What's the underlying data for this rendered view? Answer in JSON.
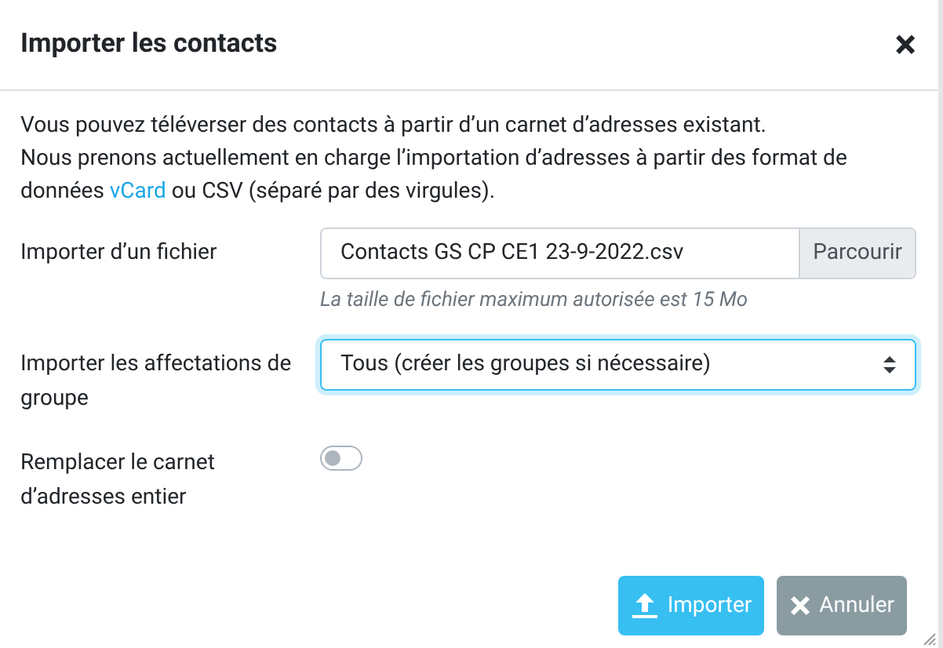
{
  "dialog": {
    "title": "Importer les contacts",
    "close": "×"
  },
  "description": {
    "before": "Vous pouvez téléverser des contacts à partir d’un carnet d’adresses existant.\nNous prenons actuellement en charge l’importation d’adresses à partir des format de données ",
    "link": "vCard",
    "after": " ou CSV (séparé par des virgules)."
  },
  "fields": [
    {
      "kind": "file",
      "label": "Importer d’un fichier",
      "value": "Contacts GS CP CE1 23-9-2022.csv",
      "button": "Parcourir",
      "hint": "La taille de fichier maximum autorisée est 15 Mo"
    },
    {
      "kind": "select",
      "label": "Importer les affectations de groupe",
      "value": "Tous (créer les groupes si nécessaire)",
      "focused": true
    },
    {
      "kind": "toggle",
      "label": "Remplacer le carnet d’adresses entier",
      "on": false
    }
  ],
  "buttons": [
    {
      "kind": "import",
      "label": "Importer"
    },
    {
      "kind": "cancel",
      "label": "Annuler"
    }
  ]
}
